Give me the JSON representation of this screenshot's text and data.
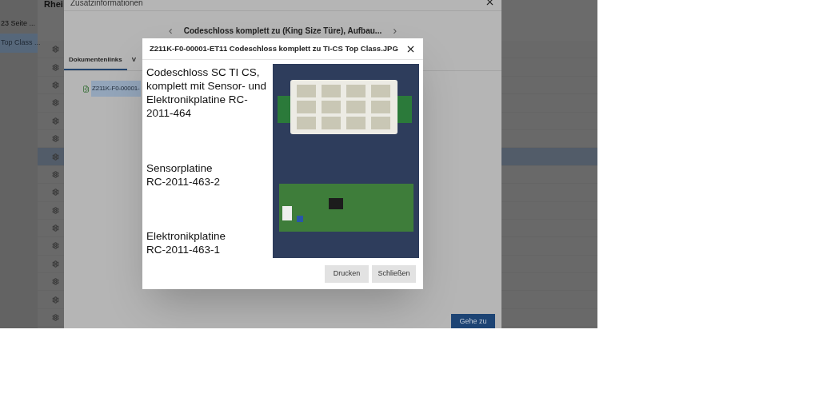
{
  "app": {
    "title": "Rhei",
    "sidebar": {
      "items": [
        {
          "label": "23 Seite ...",
          "selected": false
        },
        {
          "label": "Top Class ...",
          "selected": true
        }
      ]
    },
    "rows": [
      {
        "selected": false
      },
      {
        "selected": false
      },
      {
        "selected": false
      },
      {
        "selected": false
      },
      {
        "selected": false
      },
      {
        "selected": false
      },
      {
        "selected": true
      },
      {
        "selected": false
      },
      {
        "selected": false
      },
      {
        "selected": false
      },
      {
        "selected": false
      },
      {
        "selected": false
      },
      {
        "selected": false
      },
      {
        "selected": false
      },
      {
        "selected": false
      },
      {
        "selected": false
      }
    ]
  },
  "info_dialog": {
    "title": "Zusatzinformationen",
    "nav_prev": "‹",
    "nav_title": "Codeschloss komplett zu (King Size Türe), Aufbau...",
    "nav_next": "›",
    "tabs": [
      {
        "label": "Dokumentenlinks",
        "selected": true
      },
      {
        "label": "V",
        "selected": false
      }
    ],
    "links": [
      {
        "label": "Z211K-F0-00001-",
        "selected": true
      }
    ],
    "go_button": "Gehe zu"
  },
  "image_dialog": {
    "title": "Z211K-F0-00001-ET11 Codeschloss komplett zu TI-CS Top Class.JPG",
    "captions": [
      "Codeschloss SC TI CS, komplett mit Sensor- und Elektronikplatine RC-2011-464",
      "Sensorplatine RC-2011-463-2",
      "Elektronikplatine RC-2011-463-1"
    ],
    "buttons": [
      "Drucken",
      "Schließen"
    ]
  }
}
